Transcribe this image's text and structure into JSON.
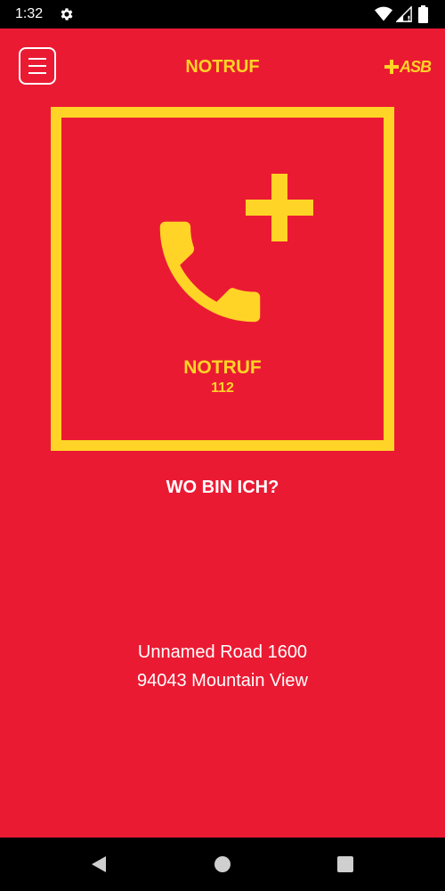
{
  "status_bar": {
    "time": "1:32",
    "icons": [
      "gear-icon",
      "wifi-icon",
      "cell-signal-icon",
      "battery-icon"
    ]
  },
  "header": {
    "title": "NOTRUF",
    "brand_text": "ASB",
    "menu_icon": "hamburger-menu-icon"
  },
  "emergency_button": {
    "label": "NOTRUF",
    "number": "112",
    "icons": [
      "phone-icon",
      "plus-icon"
    ]
  },
  "location": {
    "heading": "WO BIN ICH?",
    "address_line_1": "Unnamed Road 1600",
    "address_line_2": "94043 Mountain View"
  },
  "nav_bar": {
    "icons": [
      "back-icon",
      "home-icon",
      "recents-icon"
    ]
  },
  "colors": {
    "background": "#eb1a33",
    "accent_yellow": "#ffd426",
    "text_white": "#ffffff",
    "system_bar": "#000000"
  }
}
